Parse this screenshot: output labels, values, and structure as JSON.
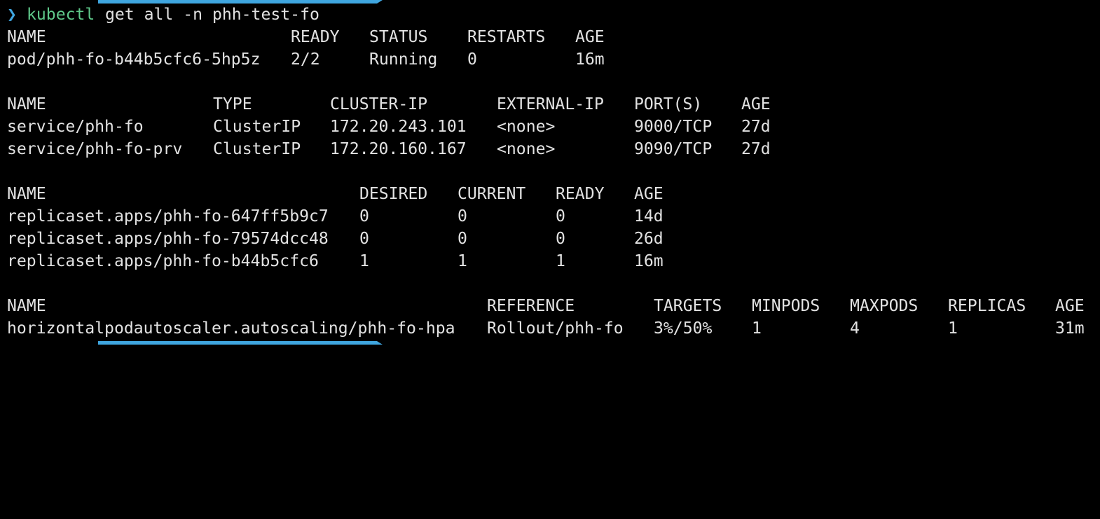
{
  "window": {
    "accent_color": "#3fa6e0",
    "command_color": "#5fc98a",
    "text_color": "#e2e2e2",
    "background": "#000000"
  },
  "prompt": {
    "symbol": "❯",
    "command": "kubectl",
    "args": "get all -n phh-test-fo"
  },
  "pods": {
    "headers": [
      "NAME",
      "READY",
      "STATUS",
      "RESTARTS",
      "AGE"
    ],
    "rows": [
      [
        "pod/phh-fo-b44b5cfc6-5hp5z",
        "2/2",
        "Running",
        "0",
        "16m"
      ]
    ]
  },
  "services": {
    "headers": [
      "NAME",
      "TYPE",
      "CLUSTER-IP",
      "EXTERNAL-IP",
      "PORT(S)",
      "AGE"
    ],
    "rows": [
      [
        "service/phh-fo",
        "ClusterIP",
        "172.20.243.101",
        "<none>",
        "9000/TCP",
        "27d"
      ],
      [
        "service/phh-fo-prv",
        "ClusterIP",
        "172.20.160.167",
        "<none>",
        "9090/TCP",
        "27d"
      ]
    ]
  },
  "replicasets": {
    "headers": [
      "NAME",
      "DESIRED",
      "CURRENT",
      "READY",
      "AGE"
    ],
    "rows": [
      [
        "replicaset.apps/phh-fo-647ff5b9c7",
        "0",
        "0",
        "0",
        "14d"
      ],
      [
        "replicaset.apps/phh-fo-79574dcc48",
        "0",
        "0",
        "0",
        "26d"
      ],
      [
        "replicaset.apps/phh-fo-b44b5cfc6",
        "1",
        "1",
        "1",
        "16m"
      ]
    ]
  },
  "hpa": {
    "headers": [
      "NAME",
      "REFERENCE",
      "TARGETS",
      "MINPODS",
      "MAXPODS",
      "REPLICAS",
      "AGE"
    ],
    "rows": [
      [
        "horizontalpodautoscaler.autoscaling/phh-fo-hpa",
        "Rollout/phh-fo",
        "3%/50%",
        "1",
        "4",
        "1",
        "31m"
      ]
    ]
  }
}
